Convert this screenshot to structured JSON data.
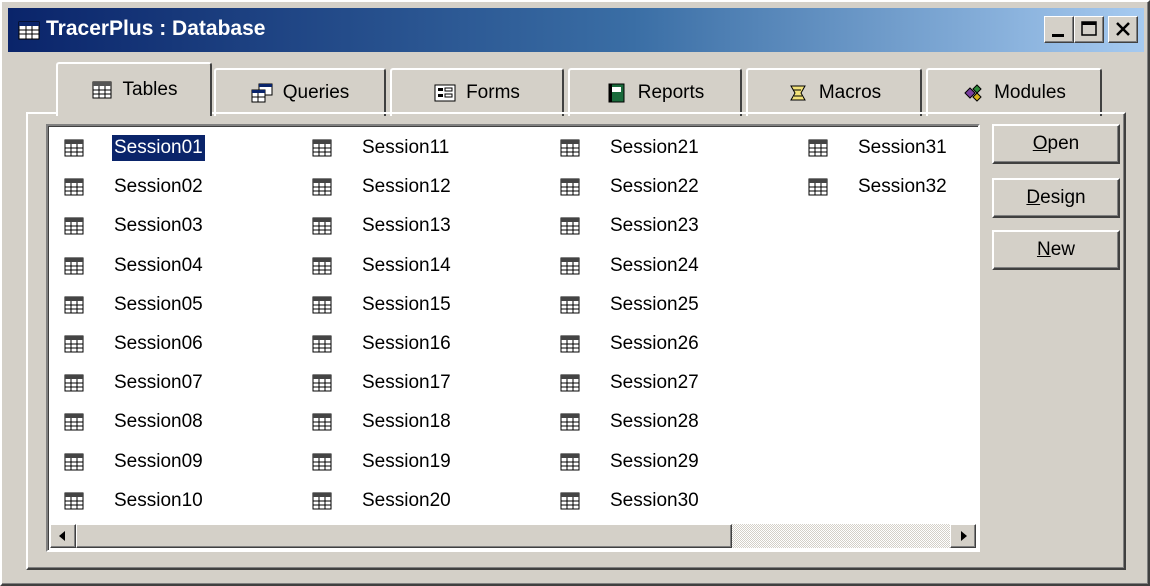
{
  "window": {
    "title": "TracerPlus : Database"
  },
  "title_buttons": {
    "min": "minimize-icon",
    "max": "maximize-icon",
    "close": "close-icon"
  },
  "tabs": [
    {
      "label": "Tables",
      "icon": "table-icon",
      "active": true
    },
    {
      "label": "Queries",
      "icon": "query-icon",
      "active": false
    },
    {
      "label": "Forms",
      "icon": "form-icon",
      "active": false
    },
    {
      "label": "Reports",
      "icon": "report-icon",
      "active": false
    },
    {
      "label": "Macros",
      "icon": "macro-icon",
      "active": false
    },
    {
      "label": "Modules",
      "icon": "module-icon",
      "active": false
    }
  ],
  "tables": [
    "Session01",
    "Session02",
    "Session03",
    "Session04",
    "Session05",
    "Session06",
    "Session07",
    "Session08",
    "Session09",
    "Session10",
    "Session11",
    "Session12",
    "Session13",
    "Session14",
    "Session15",
    "Session16",
    "Session17",
    "Session18",
    "Session19",
    "Session20",
    "Session21",
    "Session22",
    "Session23",
    "Session24",
    "Session25",
    "Session26",
    "Session27",
    "Session28",
    "Session29",
    "Session30",
    "Session31",
    "Session32"
  ],
  "selected_table": "Session01",
  "buttons": {
    "open": {
      "key": "O",
      "rest": "pen"
    },
    "design": {
      "key": "D",
      "rest": "esign"
    },
    "new": {
      "key": "N",
      "rest": "ew"
    }
  },
  "colors": {
    "title_start": "#0a246a",
    "title_end": "#a6caf0",
    "selection": "#0a246a",
    "face": "#d4d0c8"
  }
}
